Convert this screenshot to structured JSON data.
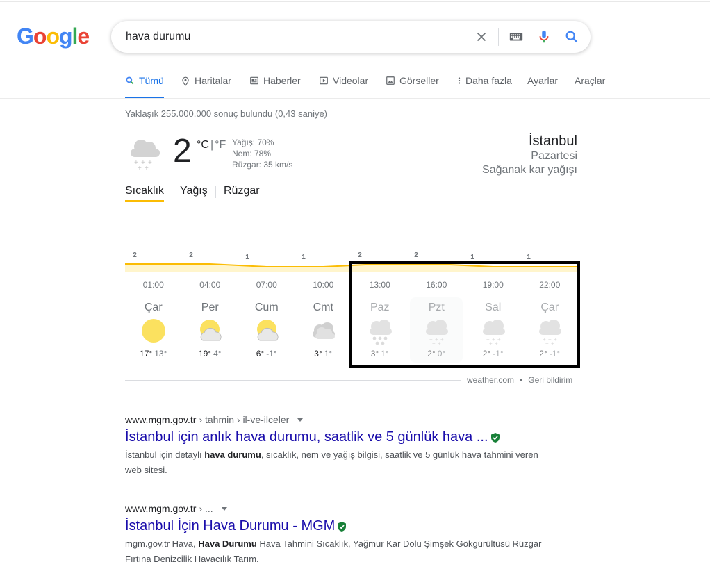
{
  "logo": {
    "letters": [
      "G",
      "o",
      "o",
      "g",
      "l",
      "e"
    ],
    "colors": [
      "#4285f4",
      "#ea4335",
      "#fbbc05",
      "#4285f4",
      "#34a853",
      "#ea4335"
    ]
  },
  "search": {
    "query": "hava durumu"
  },
  "tabs": [
    {
      "label": "Tümü",
      "icon": "search-icon",
      "active": true
    },
    {
      "label": "Haritalar",
      "icon": "map-pin-icon"
    },
    {
      "label": "Haberler",
      "icon": "news-icon"
    },
    {
      "label": "Videolar",
      "icon": "video-icon"
    },
    {
      "label": "Görseller",
      "icon": "image-icon"
    },
    {
      "label": "Daha fazla",
      "icon": "more-vert-icon"
    },
    {
      "label": "Ayarlar"
    },
    {
      "label": "Araçlar"
    }
  ],
  "stats": "Yaklaşık 255.000.000 sonuç bulundu (0,43 saniye)",
  "weather": {
    "temp": "2",
    "unit_c": "°C",
    "unit_sep": "|",
    "unit_f": "°F",
    "precip": "Yağış: 70%",
    "humidity": "Nem: 78%",
    "wind": "Rüzgar: 35 km/s",
    "city": "İstanbul",
    "day": "Pazartesi",
    "condition": "Sağanak kar yağışı",
    "view_tabs": [
      "Sıcaklık",
      "Yağış",
      "Rüzgar"
    ],
    "source_link": "weather.com",
    "source_dot": "•",
    "feedback": "Geri bildirim"
  },
  "chart_data": {
    "type": "area",
    "x": [
      "01:00",
      "04:00",
      "07:00",
      "10:00",
      "13:00",
      "16:00",
      "19:00",
      "22:00"
    ],
    "values": [
      2,
      2,
      1,
      1,
      2,
      2,
      1,
      1
    ],
    "labels": [
      "2",
      "2",
      "1",
      "1",
      "2",
      "2",
      "1",
      "1"
    ],
    "color": "#fbbc04",
    "fill": "#fff5cc"
  },
  "forecast": [
    {
      "day": "Çar",
      "icon": "sun-icon",
      "hi": "17°",
      "lo": "13°"
    },
    {
      "day": "Per",
      "icon": "partly-cloudy-icon",
      "hi": "19°",
      "lo": "4°"
    },
    {
      "day": "Cum",
      "icon": "partly-cloudy-icon",
      "hi": "6°",
      "lo": "-1°"
    },
    {
      "day": "Cmt",
      "icon": "cloudy-icon",
      "hi": "3°",
      "lo": "1°"
    },
    {
      "day": "Paz",
      "icon": "snow-heavy-icon",
      "hi": "3°",
      "lo": "1°"
    },
    {
      "day": "Pzt",
      "icon": "snow-icon",
      "hi": "2°",
      "lo": "0°",
      "selected": true
    },
    {
      "day": "Sal",
      "icon": "snow-icon",
      "hi": "2°",
      "lo": "-1°"
    },
    {
      "day": "Çar",
      "icon": "snow-icon",
      "hi": "2°",
      "lo": "-1°"
    }
  ],
  "results": [
    {
      "site": "www.mgm.gov.tr",
      "crumbs": "› tahmin › il-ve-ilceler",
      "title": "İstanbul için anlık hava durumu, saatlik ve 5 günlük hava ...",
      "snippet_pre": "İstanbul için detaylı ",
      "snippet_bold": "hava durumu",
      "snippet_post": ", sıcaklık, nem ve yağış bilgisi, saatlik ve 5 günlük hava tahmini veren web sitesi."
    },
    {
      "site": "www.mgm.gov.tr",
      "crumbs": "› ...",
      "title": "İstanbul İçin Hava Durumu - MGM",
      "snippet_pre": "mgm.gov.tr Hava, ",
      "snippet_bold": "Hava Durumu",
      "snippet_post": " Hava Tahmini Sıcaklık, Yağmur Kar Dolu Şimşek Gökgürültüsü Rüzgar Fırtına Denizcilik Havacılık Tarım."
    }
  ]
}
